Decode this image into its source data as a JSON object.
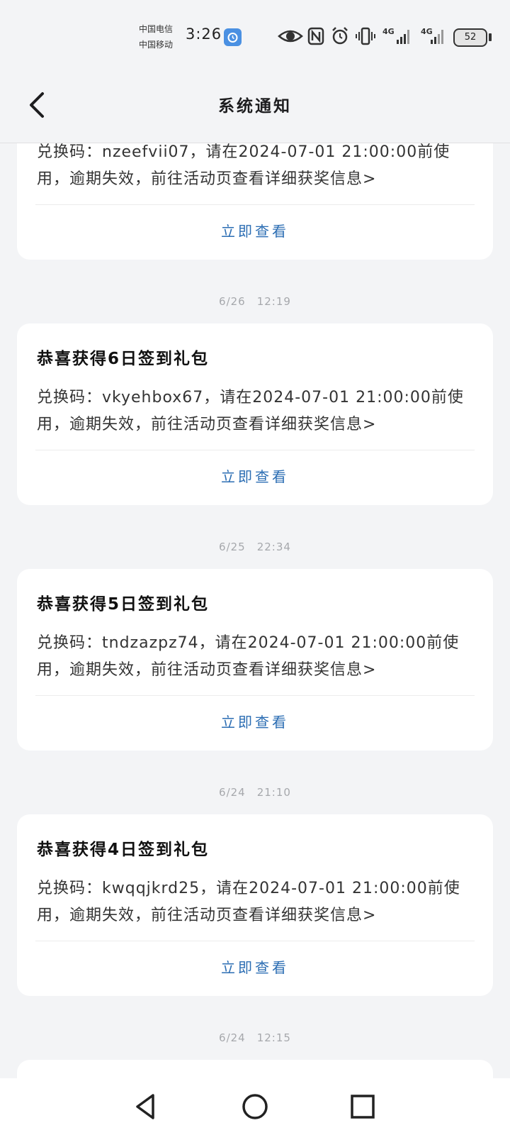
{
  "status_bar": {
    "carrier_1": "中国电信",
    "carrier_2": "中国移动",
    "time": "3:26",
    "network_1": "4G",
    "network_2": "4G",
    "battery": "52",
    "icons": [
      "alarm-badge-icon",
      "eye-icon",
      "nfc-icon",
      "alarm-clock-icon",
      "vibrate-icon",
      "signal-icon",
      "battery-icon"
    ]
  },
  "header": {
    "title": "系统通知",
    "back_icon": "chevron-left-icon"
  },
  "cards": [
    {
      "body": "兑换码：nzeefvii07，请在2024-07-01 21:00:00前使用，逾期失效，前往活动页查看详细获奖信息>",
      "action": "立即查看"
    },
    {
      "time": "6/26　12:19",
      "title": "恭喜获得6日签到礼包",
      "body": "兑换码：vkyehbox67，请在2024-07-01 21:00:00前使用，逾期失效，前往活动页查看详细获奖信息>",
      "action": "立即查看"
    },
    {
      "time": "6/25　22:34",
      "title": "恭喜获得5日签到礼包",
      "body": "兑换码：tndzazpz74，请在2024-07-01 21:00:00前使用，逾期失效，前往活动页查看详细获奖信息>",
      "action": "立即查看"
    },
    {
      "time": "6/24　21:10",
      "title": "恭喜获得4日签到礼包",
      "body": "兑换码：kwqqjkrd25，请在2024-07-01 21:00:00前使用，逾期失效，前往活动页查看详细获奖信息>",
      "action": "立即查看"
    },
    {
      "time": "6/24　12:15"
    }
  ],
  "nav": {
    "icons": [
      "back-triangle-icon",
      "home-circle-icon",
      "recents-square-icon"
    ]
  },
  "colors": {
    "background": "#f3f4f6",
    "card": "#ffffff",
    "link": "#2b6db3",
    "timestamp": "#a6a8ac"
  }
}
